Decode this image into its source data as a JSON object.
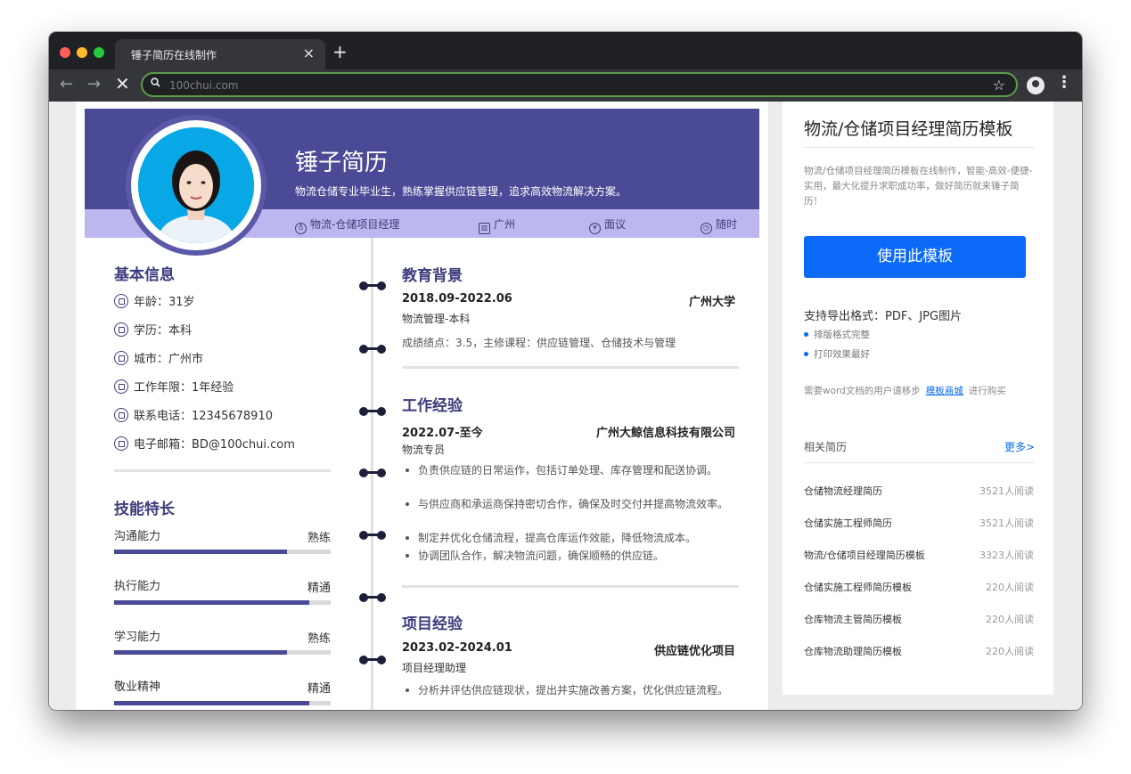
{
  "browser": {
    "tab_title": "锤子简历在线制作",
    "tab_close": "×",
    "new_tab": "+",
    "back": "←",
    "forward": "→",
    "stop": "✕",
    "search_glyph": "⚲",
    "url": "100chui.com",
    "star": "☆",
    "menu": "⋮"
  },
  "resume": {
    "name": "锤子简历",
    "summary": "物流仓储专业毕业生，熟练掌握供应链管理，追求高效物流解决方案。",
    "info_bar": [
      {
        "icon": "tie-icon",
        "glyph": "♁",
        "text": "物流-仓储项目经理"
      },
      {
        "icon": "building-icon",
        "glyph": "▥",
        "text": "广州"
      },
      {
        "icon": "yen-icon",
        "glyph": "¥",
        "text": "面议"
      },
      {
        "icon": "clock-icon",
        "glyph": "◷",
        "text": "随时"
      }
    ],
    "basic": {
      "title": "基本信息",
      "items": [
        {
          "icon": "age-icon",
          "text": "年龄：31岁"
        },
        {
          "icon": "education-icon",
          "text": "学历：本科"
        },
        {
          "icon": "city-icon",
          "text": "城市：广州市"
        },
        {
          "icon": "work-years-icon",
          "text": "工作年限：1年经验"
        },
        {
          "icon": "phone-icon",
          "text": "联系电话：12345678910"
        },
        {
          "icon": "email-icon",
          "text": "电子邮箱：BD@100chui.com"
        }
      ]
    },
    "skills": {
      "title": "技能特长",
      "items": [
        {
          "label": "沟通能力",
          "level": "熟练",
          "value": 0.8
        },
        {
          "label": "执行能力",
          "level": "精通",
          "value": 0.9
        },
        {
          "label": "学习能力",
          "level": "熟练",
          "value": 0.8
        },
        {
          "label": "敬业精神",
          "level": "精通",
          "value": 0.9
        }
      ]
    },
    "education": {
      "title": "教育背景",
      "period": "2018.09-2022.06",
      "school": "广州大学",
      "major": "物流管理-本科",
      "detail": "成绩绩点：3.5，主修课程：供应链管理、仓储技术与管理"
    },
    "work": {
      "title": "工作经验",
      "period": "2022.07-至今",
      "company": "广州大鲸信息科技有限公司",
      "position": "物流专员",
      "bullets": [
        "负责供应链的日常运作，包括订单处理、库存管理和配送协调。",
        "与供应商和承运商保持密切合作，确保及时交付并提高物流效率。",
        "制定并优化仓储流程，提高仓库运作效能，降低物流成本。",
        "协调团队合作，解决物流问题，确保顺畅的供应链。"
      ]
    },
    "project": {
      "title": "项目经验",
      "period": "2023.02-2024.01",
      "name": "供应链优化项目",
      "role": "项目经理助理",
      "bullets": [
        "分析并评估供应链现状，提出并实施改善方案，优化供应链流程。"
      ]
    }
  },
  "sidebar": {
    "title": "物流/仓储项目经理简历模板",
    "description": "物流/仓储项目经理简历模板在线制作，智能-高效-便捷-实用，最大化提升求职成功率，做好简历就来锤子简历！",
    "use_button": "使用此模板",
    "export_formats": "支持导出格式：PDF、JPG图片",
    "features": [
      "排版格式完整",
      "打印效果最好"
    ],
    "word_prefix": "需要word文档的用户请移步",
    "word_link": "模板商城",
    "word_suffix": "进行购买",
    "related_title": "相关简历",
    "more": "更多>",
    "related": [
      {
        "name": "仓储物流经理简历",
        "views": "3521人阅读"
      },
      {
        "name": "仓储实施工程师简历",
        "views": "3521人阅读"
      },
      {
        "name": "物流/仓储项目经理简历模板",
        "views": "3323人阅读"
      },
      {
        "name": "仓储实施工程师简历模板",
        "views": "220人阅读"
      },
      {
        "name": "仓库物流主管简历模板",
        "views": "220人阅读"
      },
      {
        "name": "仓库物流助理简历模板",
        "views": "220人阅读"
      }
    ]
  },
  "colors": {
    "accent": "#4b4a96",
    "info_bar": "#bdb7ef",
    "button": "#0b6af7"
  }
}
